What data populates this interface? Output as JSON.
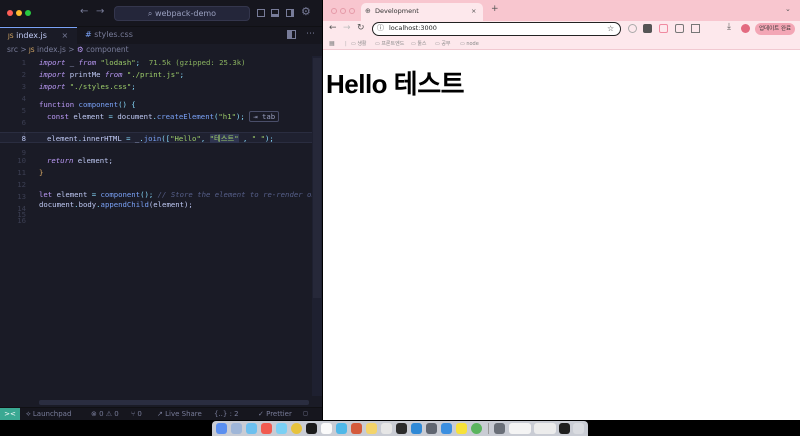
{
  "vscode": {
    "search_text": "webpack-demo",
    "tabs": [
      {
        "badge": "JS",
        "label": "index.js"
      },
      {
        "badge": "#",
        "label": "styles.css"
      }
    ],
    "breadcrumb": {
      "folder": "src",
      "sep1": ">",
      "file_badge": "JS",
      "file": "index.js",
      "sep2": ">",
      "symbol": "component"
    },
    "line_numbers": [
      "1",
      "2",
      "3",
      "4",
      "5",
      "6",
      "7",
      "8",
      "9",
      "10",
      "11",
      "12",
      "13",
      "14",
      "15",
      "16"
    ],
    "code": {
      "l1": {
        "kw": "import",
        "name": " _ ",
        "from": "from",
        "str": " \"lodash\"",
        "semi": ";",
        "hint": "71.5k (gzipped: 25.3k)"
      },
      "l2": {
        "kw": "import",
        "name": " printMe ",
        "from": "from",
        "str": " \"./print.js\"",
        "semi": ";"
      },
      "l3": {
        "kw": "import",
        "str": " \"./styles.css\"",
        "semi": ";"
      },
      "l5": {
        "kw": "function",
        "fn": " component",
        "rest": "() {"
      },
      "l6": {
        "kw": "const",
        "var": " element ",
        "eq": "= ",
        "obj": "document",
        "dot": ".",
        "fn": "createElement",
        "op": "(",
        "str": "\"h1\"",
        "cl": ");",
        "hint": "⇥ tab"
      },
      "l8": {
        "var": "element",
        "dot": ".",
        "prop": "innerHTML",
        "eq": " = ",
        "obj": "_",
        "dot2": ".",
        "fn": "join",
        "op": "([",
        "s1": "\"Hello\"",
        "c1": ", ",
        "s2": "\"테스트\"",
        "c2": " , ",
        "s3": "\" \"",
        "cl": ");"
      },
      "l10": {
        "kw": "return",
        "rest": " element;"
      },
      "l11": "}",
      "l13": {
        "kw": "let",
        "var": " element ",
        "eq": "= ",
        "fn": "component",
        "rest": "(); ",
        "cmt": "// Store the element to re-render on p"
      },
      "l14": {
        "obj": "document",
        "dot": ".",
        "prop": "body",
        "dot2": ".",
        "fn": "appendChild",
        "rest": "(element);"
      }
    },
    "status": {
      "remote": "><",
      "launchpad": "Launchpad",
      "problems": "⊗ 0 ⚠ 0",
      "ports": "⑂ 0",
      "live_share": "Live Share",
      "braces": "{..} : 2",
      "prettier": "✓ Prettier",
      "bell": "🔔"
    }
  },
  "browser": {
    "tab_title": "Development",
    "new_tab": "+",
    "url": "localhost:3000",
    "bookmarks": [
      "생활",
      "프론트엔드",
      "툴스",
      "공부",
      "node"
    ],
    "profile_button": "업데이트 완료",
    "heading": "Hello 테스트"
  },
  "colors": {
    "editor_bg": "#1a1b26",
    "browser_accent": "#f8c6cf",
    "status_accent": "#3aa892"
  }
}
